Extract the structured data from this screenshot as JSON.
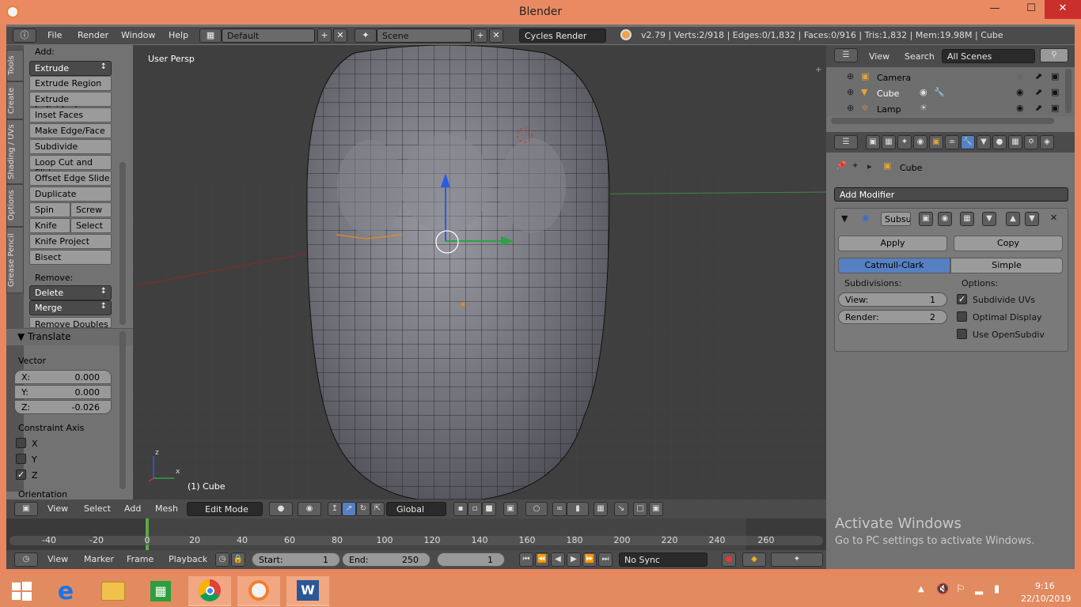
{
  "window": {
    "title": "Blender",
    "min": "—",
    "max": "☐",
    "close": "✕"
  },
  "info": {
    "menu": [
      "File",
      "Render",
      "Window",
      "Help"
    ],
    "screen_layout": "Default",
    "scene": "Scene",
    "engine": "Cycles Render",
    "stats": "v2.79 | Verts:2/918 | Edges:0/1,832 | Faces:0/916 | Tris:1,832 | Mem:19.98M | Cube"
  },
  "tabs": [
    "Tools",
    "Create",
    "Shading / UVs",
    "Options",
    "Grease Pencil"
  ],
  "tools": {
    "add_label": "Add:",
    "extrude": "Extrude",
    "buttons": [
      "Extrude Region",
      "Extrude Individual",
      "Inset Faces",
      "Make Edge/Face",
      "Subdivide",
      "Loop Cut and Slide",
      "Offset Edge Slide",
      "Duplicate"
    ],
    "spin": "Spin",
    "screw": "Screw",
    "knife": "Knife",
    "select": "Select",
    "knife_project": "Knife Project",
    "bisect": "Bisect",
    "remove_label": "Remove:",
    "delete": "Delete",
    "merge": "Merge",
    "remove_doubles": "Remove Doubles"
  },
  "translate": {
    "title": "Translate",
    "vector_label": "Vector",
    "x_label": "X:",
    "x": "0.000",
    "y_label": "Y:",
    "y": "0.000",
    "z_label": "Z:",
    "z": "-0.026",
    "constraint_label": "Constraint Axis",
    "axis_x": "X",
    "axis_y": "Y",
    "axis_z": "Z",
    "orientation": "Orientation"
  },
  "viewport": {
    "view_label": "User Persp",
    "object_label": "(1) Cube",
    "axis_x": "x",
    "axis_z": "z"
  },
  "vp_header": {
    "menu": [
      "View",
      "Select",
      "Add",
      "Mesh"
    ],
    "mode": "Edit Mode",
    "orientation": "Global"
  },
  "timeline": {
    "ticks": [
      "-40",
      "-20",
      "0",
      "20",
      "40",
      "60",
      "80",
      "100",
      "120",
      "140",
      "160",
      "180",
      "200",
      "220",
      "240",
      "260"
    ],
    "menu": [
      "View",
      "Marker",
      "Frame",
      "Playback"
    ],
    "start_label": "Start:",
    "start": "1",
    "end_label": "End:",
    "end": "250",
    "current": "1",
    "sync": "No Sync"
  },
  "outliner": {
    "view": "View",
    "search": "Search",
    "filter": "All Scenes",
    "items": [
      "Camera",
      "Cube",
      "Lamp"
    ]
  },
  "properties": {
    "object": "Cube",
    "add_modifier": "Add Modifier",
    "modifier_name": "Subsu",
    "apply": "Apply",
    "copy": "Copy",
    "catmull": "Catmull-Clark",
    "simple": "Simple",
    "subdivisions": "Subdivisions:",
    "view_label": "View:",
    "view_val": "1",
    "render_label": "Render:",
    "render_val": "2",
    "options": "Options:",
    "opt1": "Subdivide UVs",
    "opt2": "Optimal Display",
    "opt3": "Use OpenSubdiv"
  },
  "watermark": {
    "line1": "Activate Windows",
    "line2": "Go to PC settings to activate Windows."
  },
  "taskbar": {
    "time": "9:16",
    "date": "22/10/2019"
  }
}
